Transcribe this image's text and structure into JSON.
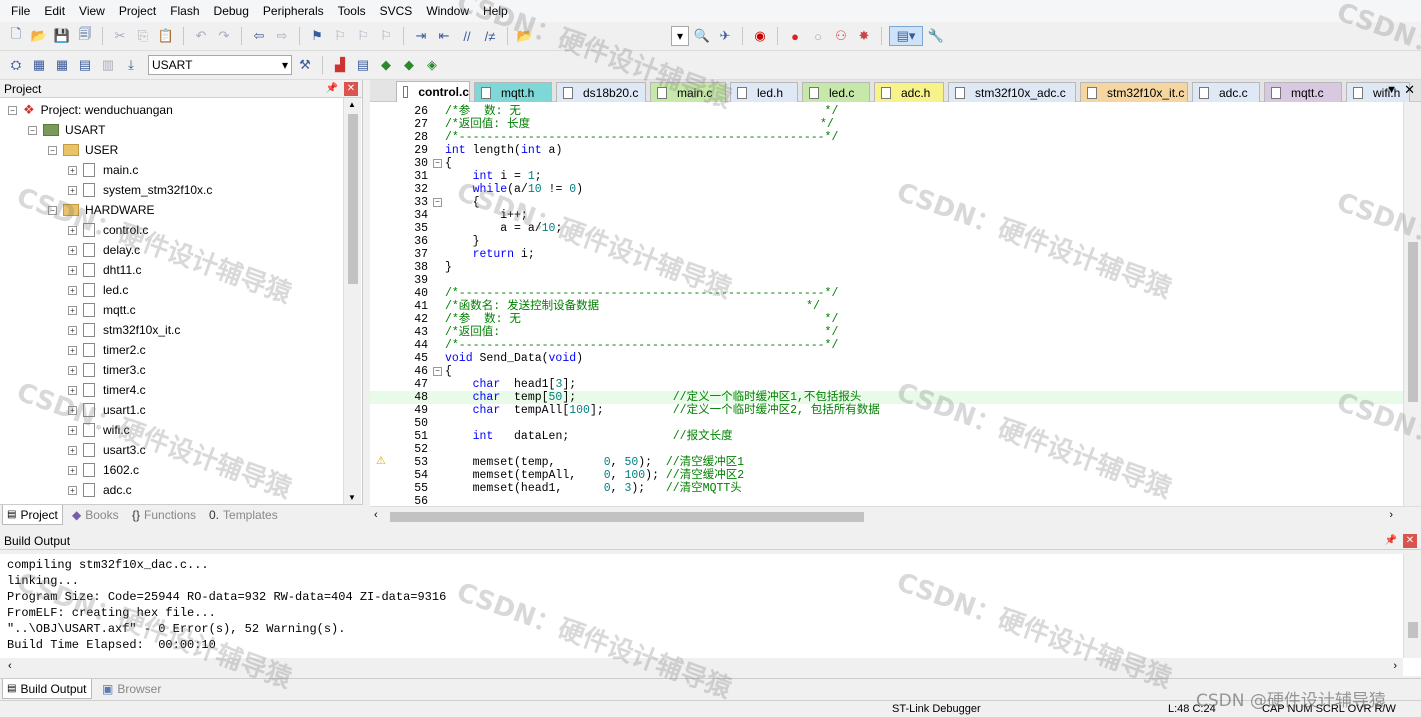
{
  "menu": [
    "File",
    "Edit",
    "View",
    "Project",
    "Flash",
    "Debug",
    "Peripherals",
    "Tools",
    "SVCS",
    "Window",
    "Help"
  ],
  "toolbar": {
    "target_combo": "USART"
  },
  "project_panel": {
    "title": "Project",
    "root": "Project: wenduchuangan",
    "target": "USART",
    "groups": [
      {
        "name": "USER",
        "files": [
          "main.c",
          "system_stm32f10x.c"
        ]
      },
      {
        "name": "HARDWARE",
        "files": [
          "control.c",
          "delay.c",
          "dht11.c",
          "led.c",
          "mqtt.c",
          "stm32f10x_it.c",
          "timer2.c",
          "timer3.c",
          "timer4.c",
          "usart1.c",
          "wifi.c",
          "usart3.c",
          "1602.c",
          "adc.c"
        ]
      }
    ],
    "tabs": [
      "Project",
      "Books",
      "Functions",
      "Templates"
    ]
  },
  "editor_tabs": [
    {
      "label": "control.c",
      "color": "#ffffff",
      "active": true
    },
    {
      "label": "mqtt.h",
      "color": "#7fd8d8"
    },
    {
      "label": "ds18b20.c",
      "color": "#dfe8f5"
    },
    {
      "label": "main.c",
      "color": "#c6e8a8"
    },
    {
      "label": "led.h",
      "color": "#dfe8f5"
    },
    {
      "label": "led.c",
      "color": "#c6e8a8"
    },
    {
      "label": "adc.h",
      "color": "#f7f38a"
    },
    {
      "label": "stm32f10x_adc.c",
      "color": "#dfe8f5"
    },
    {
      "label": "stm32f10x_it.c",
      "color": "#f6d6a0"
    },
    {
      "label": "adc.c",
      "color": "#dfe8f5"
    },
    {
      "label": "mqtt.c",
      "color": "#d8c8e0"
    },
    {
      "label": "wifi.h",
      "color": "#dfe8f5"
    }
  ],
  "code_lines": [
    {
      "n": "26",
      "t": "/*参  数: 无                                            */",
      "cls": "cm"
    },
    {
      "n": "27",
      "t": "/*返回值: 长度                                          */",
      "cls": "cm"
    },
    {
      "n": "28",
      "t": "/*-----------------------------------------------------*/",
      "cls": "cm"
    },
    {
      "n": "29",
      "t": "int length(int a)",
      "cls": ""
    },
    {
      "n": "30",
      "t": "{",
      "cls": ""
    },
    {
      "n": "31",
      "t": "    int i = 1;",
      "cls": ""
    },
    {
      "n": "32",
      "t": "    while(a/10 != 0)",
      "cls": ""
    },
    {
      "n": "33",
      "t": "    {",
      "cls": ""
    },
    {
      "n": "34",
      "t": "        i++;",
      "cls": ""
    },
    {
      "n": "35",
      "t": "        a = a/10;",
      "cls": ""
    },
    {
      "n": "36",
      "t": "    }",
      "cls": ""
    },
    {
      "n": "37",
      "t": "    return i;",
      "cls": ""
    },
    {
      "n": "38",
      "t": "}",
      "cls": ""
    },
    {
      "n": "39",
      "t": "",
      "cls": ""
    },
    {
      "n": "40",
      "t": "/*-----------------------------------------------------*/",
      "cls": "cm"
    },
    {
      "n": "41",
      "t": "/*函数名: 发送控制设备数据                              */",
      "cls": "cm"
    },
    {
      "n": "42",
      "t": "/*参  数: 无                                            */",
      "cls": "cm"
    },
    {
      "n": "43",
      "t": "/*返回值:                                               */",
      "cls": "cm"
    },
    {
      "n": "44",
      "t": "/*-----------------------------------------------------*/",
      "cls": "cm"
    },
    {
      "n": "45",
      "t": "void Send_Data(void)",
      "cls": ""
    },
    {
      "n": "46",
      "t": "{",
      "cls": ""
    },
    {
      "n": "47",
      "t": "    char  head1[3];",
      "cls": ""
    },
    {
      "n": "48",
      "t": "    char  temp[50];              //定义一个临时缓冲区1,不包括报头",
      "cls": ""
    },
    {
      "n": "49",
      "t": "    char  tempAll[100];          //定义一个临时缓冲区2, 包括所有数据",
      "cls": ""
    },
    {
      "n": "50",
      "t": "",
      "cls": ""
    },
    {
      "n": "51",
      "t": "    int   dataLen;               //报文长度",
      "cls": ""
    },
    {
      "n": "52",
      "t": "",
      "cls": ""
    },
    {
      "n": "53",
      "t": "    memset(temp,       0, 50);  //清空缓冲区1",
      "cls": ""
    },
    {
      "n": "54",
      "t": "    memset(tempAll,    0, 100); //清空缓冲区2",
      "cls": ""
    },
    {
      "n": "55",
      "t": "    memset(head1,      0, 3);   //清空MQTT头",
      "cls": ""
    },
    {
      "n": "56",
      "t": "",
      "cls": ""
    }
  ],
  "build_output": {
    "title": "Build Output",
    "lines": [
      "compiling stm32f10x_dac.c...",
      "linking...",
      "Program Size: Code=25944 RO-data=932 RW-data=404 ZI-data=9316",
      "FromELF: creating hex file...",
      "\"..\\OBJ\\USART.axf\" - 0 Error(s), 52 Warning(s).",
      "Build Time Elapsed:  00:00:10"
    ],
    "tabs": [
      "Build Output",
      "Browser"
    ]
  },
  "status": {
    "debugger": "ST-Link Debugger",
    "position": "L:48 C:24",
    "flags": "CAP NUM SCRL OVR R/W"
  },
  "watermark": "CSDN：硬件设计辅导猿",
  "footer_watermark": "CSDN @硬件设计辅导猿"
}
